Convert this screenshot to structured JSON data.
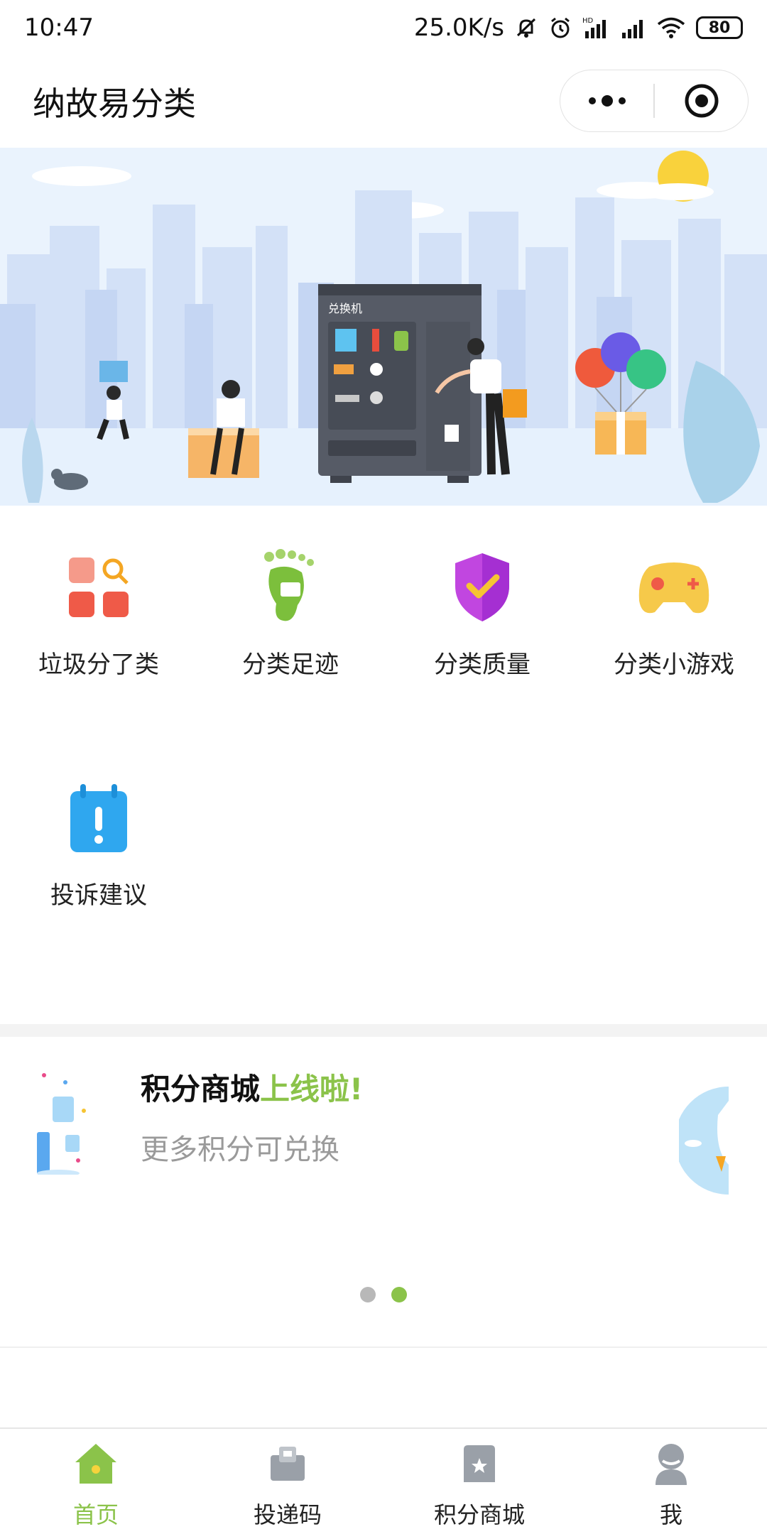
{
  "status_bar": {
    "time": "10:47",
    "speed": "25.0K/s",
    "battery": "80",
    "network_tag": "HD"
  },
  "header": {
    "title": "纳故易分类"
  },
  "banner": {
    "machine_label": "兑换机"
  },
  "grid": {
    "items": [
      {
        "label": "垃圾分了类",
        "icon": "sort-search-icon"
      },
      {
        "label": "分类足迹",
        "icon": "footprint-icon"
      },
      {
        "label": "分类质量",
        "icon": "shield-check-icon"
      },
      {
        "label": "分类小游戏",
        "icon": "gamepad-icon"
      },
      {
        "label": "投诉建议",
        "icon": "complaint-icon"
      }
    ]
  },
  "promo": {
    "title_main": "积分商城",
    "title_highlight": "上线啦!",
    "subtitle": "更多积分可兑换",
    "page_count": 2,
    "active_page": 2
  },
  "tabbar": {
    "items": [
      {
        "label": "首页",
        "icon": "home-icon",
        "active": true
      },
      {
        "label": "投递码",
        "icon": "delivery-code-icon",
        "active": false
      },
      {
        "label": "积分商城",
        "icon": "points-mall-icon",
        "active": false
      },
      {
        "label": "我",
        "icon": "user-icon",
        "active": false
      }
    ]
  },
  "colors": {
    "accent": "#8bc34a",
    "banner_bg": "#e9f2fd",
    "muted_text": "#9a9a9a"
  }
}
